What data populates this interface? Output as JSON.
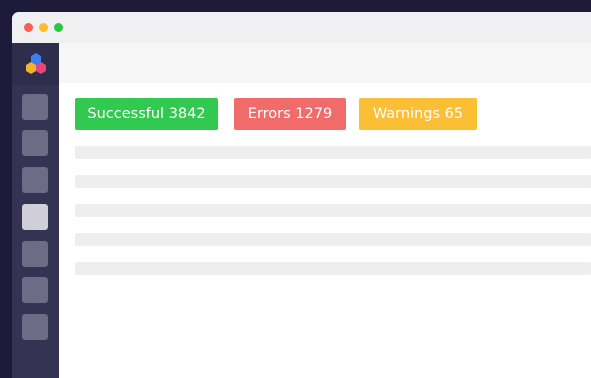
{
  "window_controls": [
    "close",
    "minimize",
    "maximize"
  ],
  "sidebar": {
    "logo_icon": "hexagon-cubes-logo",
    "item_count": 7,
    "active_index": 3
  },
  "stats": {
    "successful_label": "Successful 3842",
    "errors_label": "Errors 1279",
    "warnings_label": "Warnings 65"
  },
  "colors": {
    "success": "#31c94f",
    "error": "#f26b6b",
    "warning": "#fbbf35",
    "sidebar": "#353353"
  }
}
